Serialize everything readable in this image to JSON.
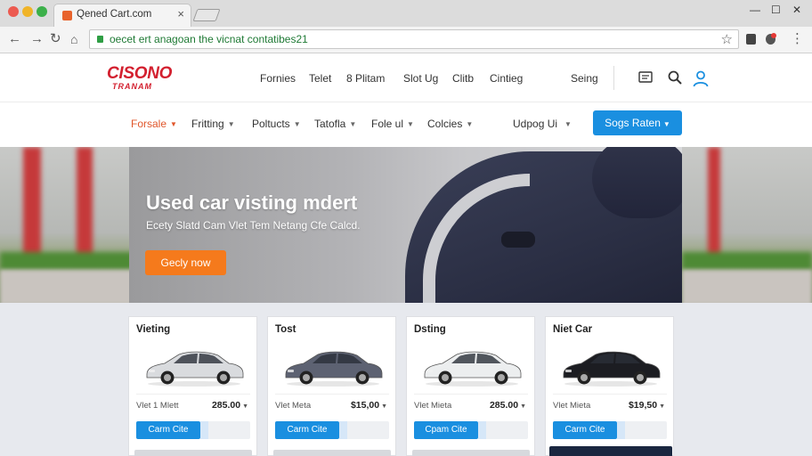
{
  "browser": {
    "tab_title": "Qened Cart.com",
    "tab_close_icon": "close-icon",
    "url": "oecet ert anagoan the vicnat contatibes21",
    "window_controls": [
      "—",
      "☐",
      "✕"
    ]
  },
  "site": {
    "logo_top": "CISONO",
    "logo_bottom": "TRANAM",
    "top_nav": [
      "Fornies",
      "Telet",
      "8 Plitam",
      "Slot Ug",
      "Clitb",
      "Cintieg",
      "Seing"
    ],
    "category_nav": [
      {
        "label": "Forsale",
        "active": true
      },
      {
        "label": "Fritting",
        "active": false
      },
      {
        "label": "Poltucts",
        "active": false
      },
      {
        "label": "Tatofla",
        "active": false
      },
      {
        "label": "Fole ul",
        "active": false
      },
      {
        "label": "Colcies",
        "active": false
      },
      {
        "label": "Udpog Ui",
        "active": false
      }
    ],
    "cta_label": "Sogs Raten"
  },
  "hero": {
    "title": "Used car visting mdert",
    "subtitle": "Ecety Slatd Cam Vlet Tem Netang Cfe Calcd.",
    "button": "Gecly now"
  },
  "listings": [
    {
      "title": "Vieting",
      "meta": "Vlet 1 Mlett",
      "price": "285.00",
      "button": "Carm Cite",
      "car_color": "#d9dbde"
    },
    {
      "title": "Tost",
      "meta": "Vlet Meta",
      "price": "$15,00",
      "button": "Carm Cite",
      "car_color": "#5d6272"
    },
    {
      "title": "Dsting",
      "meta": "Vlet Mieta",
      "price": "285.00",
      "button": "Cpam Cite",
      "car_color": "#eceeef"
    },
    {
      "title": "Niet Car",
      "meta": "Vlet Mieta",
      "price": "$19,50",
      "button": "Carm Cite",
      "car_color": "#1c1d22"
    }
  ],
  "colors": {
    "accent_blue": "#1a8fe0",
    "accent_orange": "#f57a1c",
    "brand_red": "#d3202f"
  }
}
